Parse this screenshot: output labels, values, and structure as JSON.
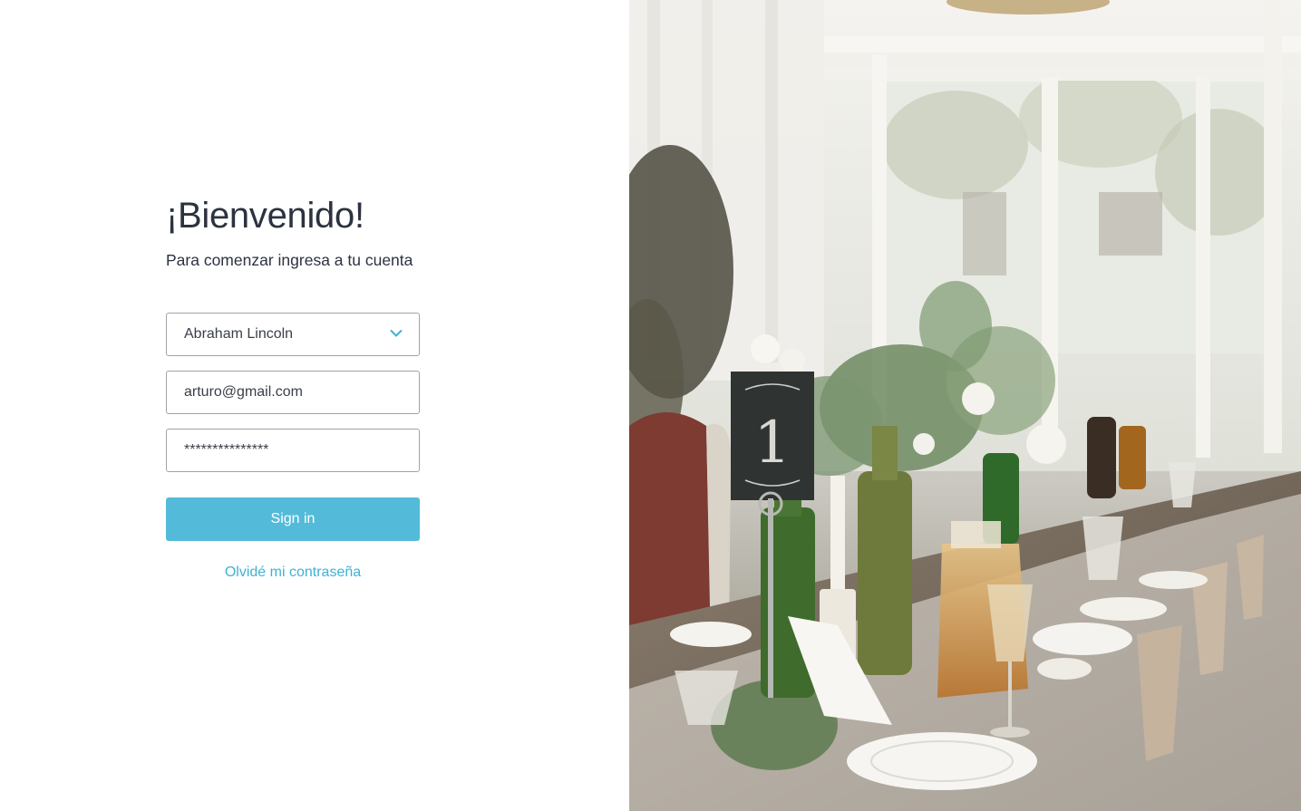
{
  "welcome": {
    "title": "¡Bienvenido!",
    "subtitle": "Para comenzar ingresa a tu cuenta"
  },
  "form": {
    "account_select": {
      "value": "Abraham Lincoln"
    },
    "email": {
      "value": "arturo@gmail.com"
    },
    "password": {
      "value": "***************"
    },
    "signin_label": "Sign in",
    "forgot_label": "Olvidé mi contraseña"
  },
  "hero_image": {
    "table_number": "1"
  },
  "colors": {
    "accent": "#53bbd9",
    "link": "#3fb2d4",
    "text": "#2c3340",
    "border": "#9fa3a8"
  },
  "icons": {
    "select_chevron": "chevron-down-icon"
  }
}
